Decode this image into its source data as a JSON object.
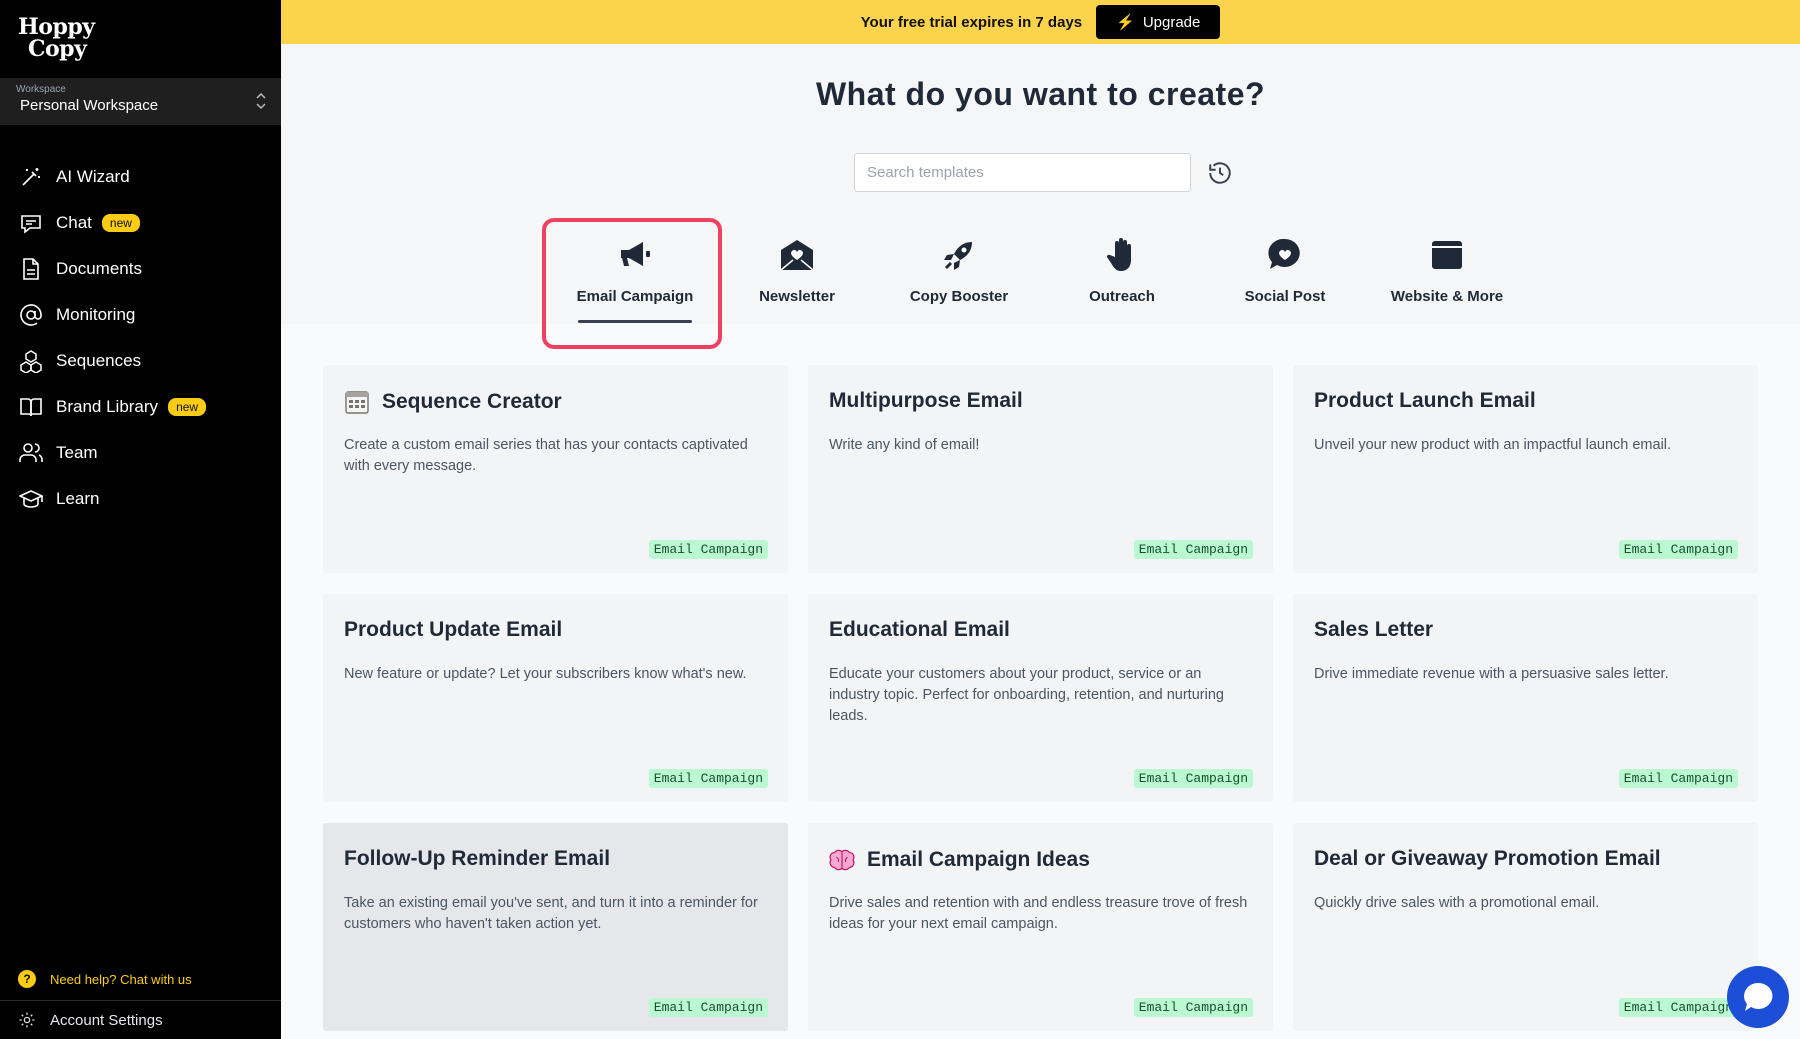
{
  "sidebar": {
    "logo_line1": "Hoppy",
    "logo_line2": "Copy",
    "workspace_label": "Workspace",
    "workspace_name": "Personal Workspace",
    "nav": [
      {
        "label": "AI Wizard",
        "icon": "magic-wand-icon"
      },
      {
        "label": "Chat",
        "icon": "chat-icon",
        "badge": "new"
      },
      {
        "label": "Documents",
        "icon": "document-icon"
      },
      {
        "label": "Monitoring",
        "icon": "at-sign-icon"
      },
      {
        "label": "Sequences",
        "icon": "cubes-icon"
      },
      {
        "label": "Brand Library",
        "icon": "book-icon",
        "badge": "new"
      },
      {
        "label": "Team",
        "icon": "users-icon"
      },
      {
        "label": "Learn",
        "icon": "graduation-cap-icon"
      }
    ],
    "help_text": "Need help? Chat with us",
    "help_icon_glyph": "?",
    "account_settings": "Account Settings"
  },
  "banner": {
    "text": "Your free trial expires in 7 days",
    "upgrade_label": "Upgrade",
    "upgrade_glyph": "⚡"
  },
  "main": {
    "title": "What do you want to create?",
    "search_placeholder": "Search templates",
    "categories": [
      {
        "label": "Email Campaign",
        "icon": "megaphone-icon",
        "active": true
      },
      {
        "label": "Newsletter",
        "icon": "envelope-heart-icon"
      },
      {
        "label": "Copy Booster",
        "icon": "rocket-icon"
      },
      {
        "label": "Outreach",
        "icon": "hand-icon"
      },
      {
        "label": "Social Post",
        "icon": "heart-bubble-icon"
      },
      {
        "label": "Website & More",
        "icon": "browser-window-icon"
      }
    ],
    "cards": [
      {
        "title": "Sequence Creator",
        "desc": "Create a custom email series that has your contacts captivated with every message.",
        "tag": "Email Campaign",
        "emoji": "calendar-icon"
      },
      {
        "title": "Multipurpose Email",
        "desc": "Write any kind of email!",
        "tag": "Email Campaign"
      },
      {
        "title": "Product Launch Email",
        "desc": "Unveil your new product with an impactful launch email.",
        "tag": "Email Campaign"
      },
      {
        "title": "Product Update Email",
        "desc": "New feature or update? Let your subscribers know what's new.",
        "tag": "Email Campaign"
      },
      {
        "title": "Educational Email",
        "desc": "Educate your customers about your product, service or an industry topic. Perfect for onboarding, retention, and nurturing leads.",
        "tag": "Email Campaign"
      },
      {
        "title": "Sales Letter",
        "desc": "Drive immediate revenue with a persuasive sales letter.",
        "tag": "Email Campaign"
      },
      {
        "title": "Follow-Up Reminder Email",
        "desc": "Take an existing email you've sent, and turn it into a reminder for customers who haven't taken action yet.",
        "tag": "Email Campaign"
      },
      {
        "title": "Email Campaign Ideas",
        "desc": "Drive sales and retention with and endless treasure trove of fresh ideas for your next email campaign.",
        "tag": "Email Campaign",
        "emoji": "brain-icon"
      },
      {
        "title": "Deal or Giveaway Promotion Email",
        "desc": "Quickly drive sales with a promotional email.",
        "tag": "Email Campaign"
      }
    ]
  },
  "colors": {
    "banner": "#fcd34d",
    "sidebar": "#000000",
    "highlight": "#ef4060",
    "tag_bg": "#bbf7d0",
    "chat_bubble": "#1d4ed8"
  }
}
